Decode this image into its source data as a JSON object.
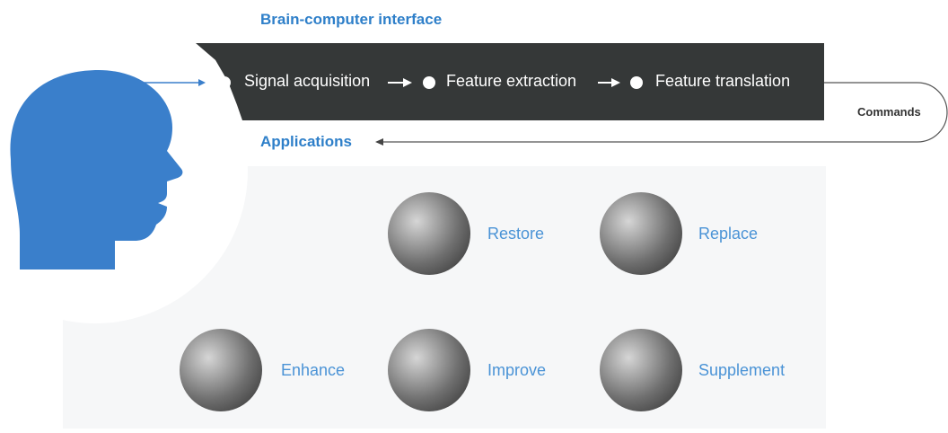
{
  "title": "Brain-computer interface",
  "pipeline": {
    "steps": [
      "Signal acquisition",
      "Feature extraction",
      "Feature translation"
    ],
    "output": "Commands"
  },
  "applications": {
    "label": "Applications",
    "items": [
      "Restore",
      "Replace",
      "Enhance",
      "Improve",
      "Supplement"
    ]
  },
  "colors": {
    "accent": "#2e7fc9",
    "head": "#3a7fcb",
    "bar": "#353838",
    "app_label": "#4a93d6"
  },
  "icons": {
    "head": "human-head-silhouette",
    "photo": "grayscale-photo-circle"
  }
}
